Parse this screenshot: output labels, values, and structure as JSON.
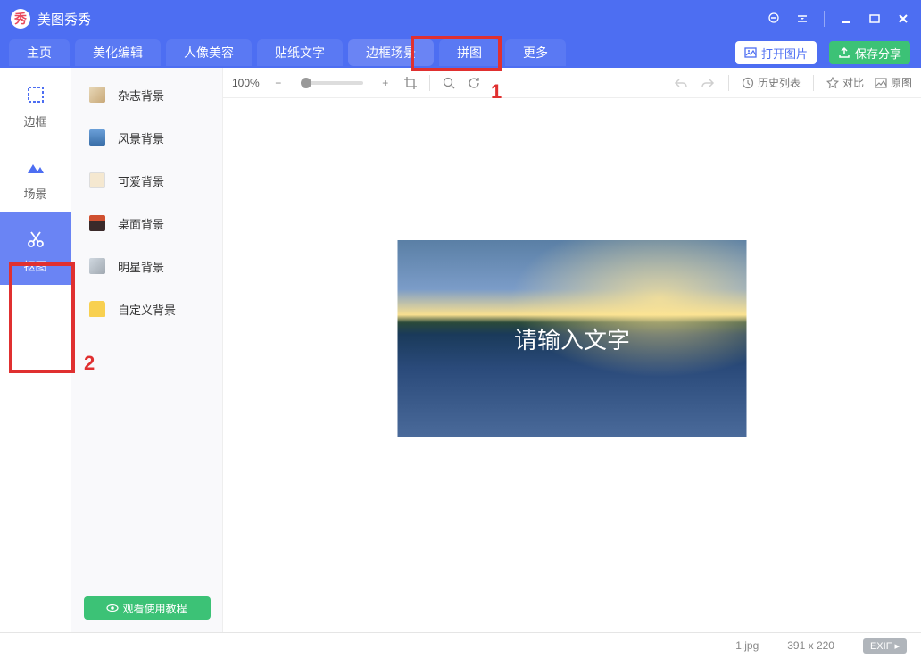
{
  "app": {
    "title": "美图秀秀"
  },
  "titlebar_icons": {
    "chat": "chat-icon",
    "menu": "menu-icon",
    "min": "minimize-icon",
    "max": "maximize-icon",
    "close": "close-icon"
  },
  "tabs": [
    {
      "label": "主页"
    },
    {
      "label": "美化编辑"
    },
    {
      "label": "人像美容"
    },
    {
      "label": "贴纸文字"
    },
    {
      "label": "边框场景",
      "active": true
    },
    {
      "label": "拼图"
    },
    {
      "label": "更多"
    }
  ],
  "action_buttons": {
    "open": "打开图片",
    "save": "保存分享"
  },
  "sidebar": [
    {
      "label": "边框",
      "icon": "frame-icon"
    },
    {
      "label": "场景",
      "icon": "scene-icon"
    },
    {
      "label": "抠图",
      "icon": "cutout-icon",
      "selected": true
    }
  ],
  "categories": [
    {
      "label": "杂志背景",
      "thumb_bg": "#d8c8a8"
    },
    {
      "label": "风景背景",
      "thumb_bg": "#6a9fd8"
    },
    {
      "label": "可爱背景",
      "thumb_bg": "#f5e8d0"
    },
    {
      "label": "桌面背景",
      "thumb_bg": "#4a3a3a"
    },
    {
      "label": "明星背景",
      "thumb_bg": "#c0c8d0"
    },
    {
      "label": "自定义背景",
      "thumb_bg": "#f8d050"
    }
  ],
  "tutorial_button": "观看使用教程",
  "canvas_toolbar": {
    "zoom": "100%",
    "history": "历史列表",
    "compare": "对比",
    "original": "原图"
  },
  "preview": {
    "text": "请输入文字"
  },
  "statusbar": {
    "filename": "1.jpg",
    "dimensions": "391 x 220",
    "exif": "EXIF ▸"
  },
  "annotations": {
    "num1": "1",
    "num2": "2"
  }
}
